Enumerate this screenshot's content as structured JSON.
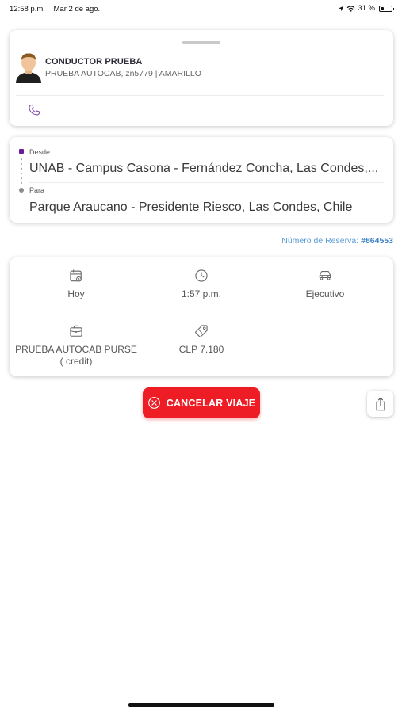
{
  "status_bar": {
    "time": "12:58 p.m.",
    "date": "Mar 2 de ago.",
    "battery_text": "31 %",
    "battery_level": 0.31
  },
  "driver": {
    "name": "CONDUCTOR PRUEBA",
    "vehicle_info": "PRUEBA AUTOCAB, zn5779 | AMARILLO",
    "avatar_icon": "driver-avatar",
    "call_icon": "phone-icon"
  },
  "route": {
    "from_label": "Desde",
    "from_value": "UNAB - Campus Casona - Fernández Concha, Las Condes,...",
    "to_label": "Para",
    "to_value": "Parque Araucano - Presidente Riesco, Las Condes, Chile"
  },
  "reservation": {
    "label": "Número de Reserva:",
    "number": "#864553"
  },
  "details": {
    "date": "Hoy",
    "time": "1:57 p.m.",
    "vehicle_type": "Ejecutivo",
    "payment_line1": "PRUEBA AUTOCAB PURSE",
    "payment_line2": "( credit)",
    "price": "CLP 7.180"
  },
  "actions": {
    "cancel_label": "CANCELAR VIAJE",
    "share_icon": "share-icon"
  },
  "colors": {
    "accent_purple": "#6a1b9a",
    "cancel_red": "#ee1c25",
    "link_blue": "#3b80c8"
  }
}
